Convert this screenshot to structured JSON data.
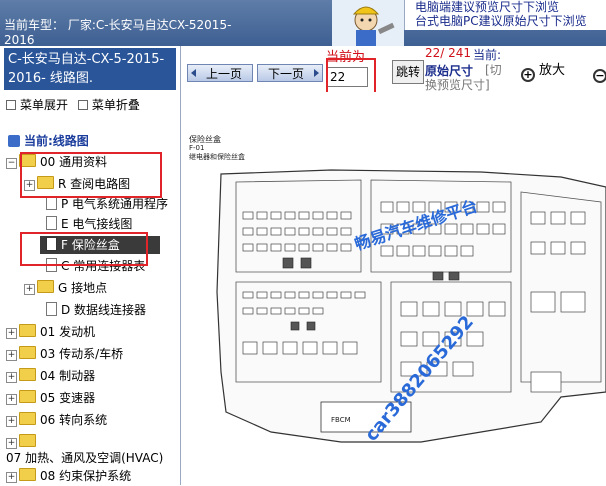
{
  "topbar": {
    "vehicle_line1": "当前车型：  厂家:C-长安马自达CX-52015-",
    "vehicle_line2": "2016",
    "notice_line1": "电脑端建议预览尺寸下浏览",
    "notice_line2": "台式电脑PC建议原始尺寸下浏览"
  },
  "left_panel": {
    "doc_title": "C-长安马自达-CX-5-2015-2016- 线路图.",
    "menu_expand": "菜单展开",
    "menu_collapse": "菜单折叠",
    "current_label": "当前:线路图",
    "tree": [
      {
        "label": "00 通用资料",
        "type": "folder",
        "expandable": true
      },
      {
        "label": "R 查阅电路图",
        "type": "folder",
        "expandable": true
      },
      {
        "label": "P 电气系统通用程序",
        "type": "doc"
      },
      {
        "label": "E 电气接线图",
        "type": "doc"
      },
      {
        "label": "F 保险丝盒",
        "type": "doc",
        "selected": true
      },
      {
        "label": "C 常用连接器表",
        "type": "doc"
      },
      {
        "label": "G 接地点",
        "type": "folder",
        "expandable": true
      },
      {
        "label": "D 数据线连接器",
        "type": "doc"
      },
      {
        "label": "01 发动机",
        "type": "folder",
        "expandable": true
      },
      {
        "label": "03 传动系/车桥",
        "type": "folder",
        "expandable": true
      },
      {
        "label": "04 制动器",
        "type": "folder",
        "expandable": true
      },
      {
        "label": "05 变速器",
        "type": "folder",
        "expandable": true
      },
      {
        "label": "06 转向系统",
        "type": "folder",
        "expandable": true
      },
      {
        "label": "07 加热、通风及空调(HVAC)",
        "type": "folder",
        "expandable": true
      },
      {
        "label": "08 约束保护系统",
        "type": "folder",
        "expandable": true
      }
    ]
  },
  "toolbar": {
    "prev_label": "上一页",
    "next_label": "下一页",
    "current_page_label": "当前为",
    "page_input_value": "22",
    "goto_label": "跳转",
    "page_count": "22/ 241",
    "page_count_suffix": "当前:",
    "original_size": "原始尺寸",
    "switch_view": "[切换预览尺寸]",
    "zoom_in": "放大"
  },
  "diagram": {
    "section_title": "保险丝盒",
    "code": "F-01",
    "subtitle": "继电器和保险丝盒",
    "watermark": "畅易汽车维修平台",
    "watermark_phone": "car3882065292"
  },
  "colors": {
    "header_blue": "#2a5599",
    "highlight_red": "#e0242a",
    "link_blue": "#1a2c8c"
  }
}
